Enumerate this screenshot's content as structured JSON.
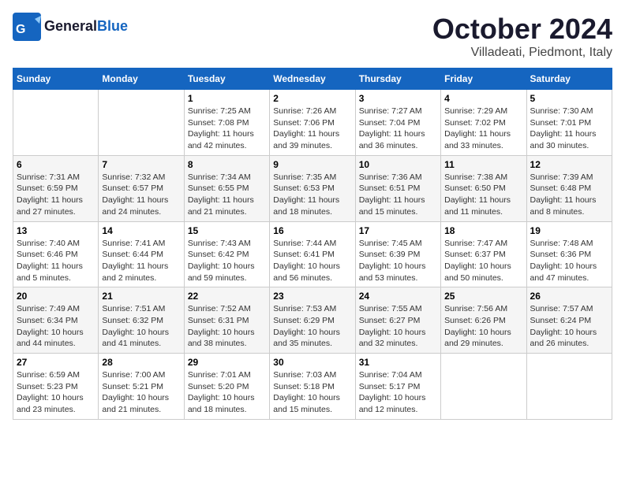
{
  "header": {
    "logo_line1": "General",
    "logo_line2": "Blue",
    "month": "October 2024",
    "location": "Villadeati, Piedmont, Italy"
  },
  "weekdays": [
    "Sunday",
    "Monday",
    "Tuesday",
    "Wednesday",
    "Thursday",
    "Friday",
    "Saturday"
  ],
  "weeks": [
    [
      {
        "day": "",
        "sunrise": "",
        "sunset": "",
        "daylight": ""
      },
      {
        "day": "",
        "sunrise": "",
        "sunset": "",
        "daylight": ""
      },
      {
        "day": "1",
        "sunrise": "Sunrise: 7:25 AM",
        "sunset": "Sunset: 7:08 PM",
        "daylight": "Daylight: 11 hours and 42 minutes."
      },
      {
        "day": "2",
        "sunrise": "Sunrise: 7:26 AM",
        "sunset": "Sunset: 7:06 PM",
        "daylight": "Daylight: 11 hours and 39 minutes."
      },
      {
        "day": "3",
        "sunrise": "Sunrise: 7:27 AM",
        "sunset": "Sunset: 7:04 PM",
        "daylight": "Daylight: 11 hours and 36 minutes."
      },
      {
        "day": "4",
        "sunrise": "Sunrise: 7:29 AM",
        "sunset": "Sunset: 7:02 PM",
        "daylight": "Daylight: 11 hours and 33 minutes."
      },
      {
        "day": "5",
        "sunrise": "Sunrise: 7:30 AM",
        "sunset": "Sunset: 7:01 PM",
        "daylight": "Daylight: 11 hours and 30 minutes."
      }
    ],
    [
      {
        "day": "6",
        "sunrise": "Sunrise: 7:31 AM",
        "sunset": "Sunset: 6:59 PM",
        "daylight": "Daylight: 11 hours and 27 minutes."
      },
      {
        "day": "7",
        "sunrise": "Sunrise: 7:32 AM",
        "sunset": "Sunset: 6:57 PM",
        "daylight": "Daylight: 11 hours and 24 minutes."
      },
      {
        "day": "8",
        "sunrise": "Sunrise: 7:34 AM",
        "sunset": "Sunset: 6:55 PM",
        "daylight": "Daylight: 11 hours and 21 minutes."
      },
      {
        "day": "9",
        "sunrise": "Sunrise: 7:35 AM",
        "sunset": "Sunset: 6:53 PM",
        "daylight": "Daylight: 11 hours and 18 minutes."
      },
      {
        "day": "10",
        "sunrise": "Sunrise: 7:36 AM",
        "sunset": "Sunset: 6:51 PM",
        "daylight": "Daylight: 11 hours and 15 minutes."
      },
      {
        "day": "11",
        "sunrise": "Sunrise: 7:38 AM",
        "sunset": "Sunset: 6:50 PM",
        "daylight": "Daylight: 11 hours and 11 minutes."
      },
      {
        "day": "12",
        "sunrise": "Sunrise: 7:39 AM",
        "sunset": "Sunset: 6:48 PM",
        "daylight": "Daylight: 11 hours and 8 minutes."
      }
    ],
    [
      {
        "day": "13",
        "sunrise": "Sunrise: 7:40 AM",
        "sunset": "Sunset: 6:46 PM",
        "daylight": "Daylight: 11 hours and 5 minutes."
      },
      {
        "day": "14",
        "sunrise": "Sunrise: 7:41 AM",
        "sunset": "Sunset: 6:44 PM",
        "daylight": "Daylight: 11 hours and 2 minutes."
      },
      {
        "day": "15",
        "sunrise": "Sunrise: 7:43 AM",
        "sunset": "Sunset: 6:42 PM",
        "daylight": "Daylight: 10 hours and 59 minutes."
      },
      {
        "day": "16",
        "sunrise": "Sunrise: 7:44 AM",
        "sunset": "Sunset: 6:41 PM",
        "daylight": "Daylight: 10 hours and 56 minutes."
      },
      {
        "day": "17",
        "sunrise": "Sunrise: 7:45 AM",
        "sunset": "Sunset: 6:39 PM",
        "daylight": "Daylight: 10 hours and 53 minutes."
      },
      {
        "day": "18",
        "sunrise": "Sunrise: 7:47 AM",
        "sunset": "Sunset: 6:37 PM",
        "daylight": "Daylight: 10 hours and 50 minutes."
      },
      {
        "day": "19",
        "sunrise": "Sunrise: 7:48 AM",
        "sunset": "Sunset: 6:36 PM",
        "daylight": "Daylight: 10 hours and 47 minutes."
      }
    ],
    [
      {
        "day": "20",
        "sunrise": "Sunrise: 7:49 AM",
        "sunset": "Sunset: 6:34 PM",
        "daylight": "Daylight: 10 hours and 44 minutes."
      },
      {
        "day": "21",
        "sunrise": "Sunrise: 7:51 AM",
        "sunset": "Sunset: 6:32 PM",
        "daylight": "Daylight: 10 hours and 41 minutes."
      },
      {
        "day": "22",
        "sunrise": "Sunrise: 7:52 AM",
        "sunset": "Sunset: 6:31 PM",
        "daylight": "Daylight: 10 hours and 38 minutes."
      },
      {
        "day": "23",
        "sunrise": "Sunrise: 7:53 AM",
        "sunset": "Sunset: 6:29 PM",
        "daylight": "Daylight: 10 hours and 35 minutes."
      },
      {
        "day": "24",
        "sunrise": "Sunrise: 7:55 AM",
        "sunset": "Sunset: 6:27 PM",
        "daylight": "Daylight: 10 hours and 32 minutes."
      },
      {
        "day": "25",
        "sunrise": "Sunrise: 7:56 AM",
        "sunset": "Sunset: 6:26 PM",
        "daylight": "Daylight: 10 hours and 29 minutes."
      },
      {
        "day": "26",
        "sunrise": "Sunrise: 7:57 AM",
        "sunset": "Sunset: 6:24 PM",
        "daylight": "Daylight: 10 hours and 26 minutes."
      }
    ],
    [
      {
        "day": "27",
        "sunrise": "Sunrise: 6:59 AM",
        "sunset": "Sunset: 5:23 PM",
        "daylight": "Daylight: 10 hours and 23 minutes."
      },
      {
        "day": "28",
        "sunrise": "Sunrise: 7:00 AM",
        "sunset": "Sunset: 5:21 PM",
        "daylight": "Daylight: 10 hours and 21 minutes."
      },
      {
        "day": "29",
        "sunrise": "Sunrise: 7:01 AM",
        "sunset": "Sunset: 5:20 PM",
        "daylight": "Daylight: 10 hours and 18 minutes."
      },
      {
        "day": "30",
        "sunrise": "Sunrise: 7:03 AM",
        "sunset": "Sunset: 5:18 PM",
        "daylight": "Daylight: 10 hours and 15 minutes."
      },
      {
        "day": "31",
        "sunrise": "Sunrise: 7:04 AM",
        "sunset": "Sunset: 5:17 PM",
        "daylight": "Daylight: 10 hours and 12 minutes."
      },
      {
        "day": "",
        "sunrise": "",
        "sunset": "",
        "daylight": ""
      },
      {
        "day": "",
        "sunrise": "",
        "sunset": "",
        "daylight": ""
      }
    ]
  ]
}
